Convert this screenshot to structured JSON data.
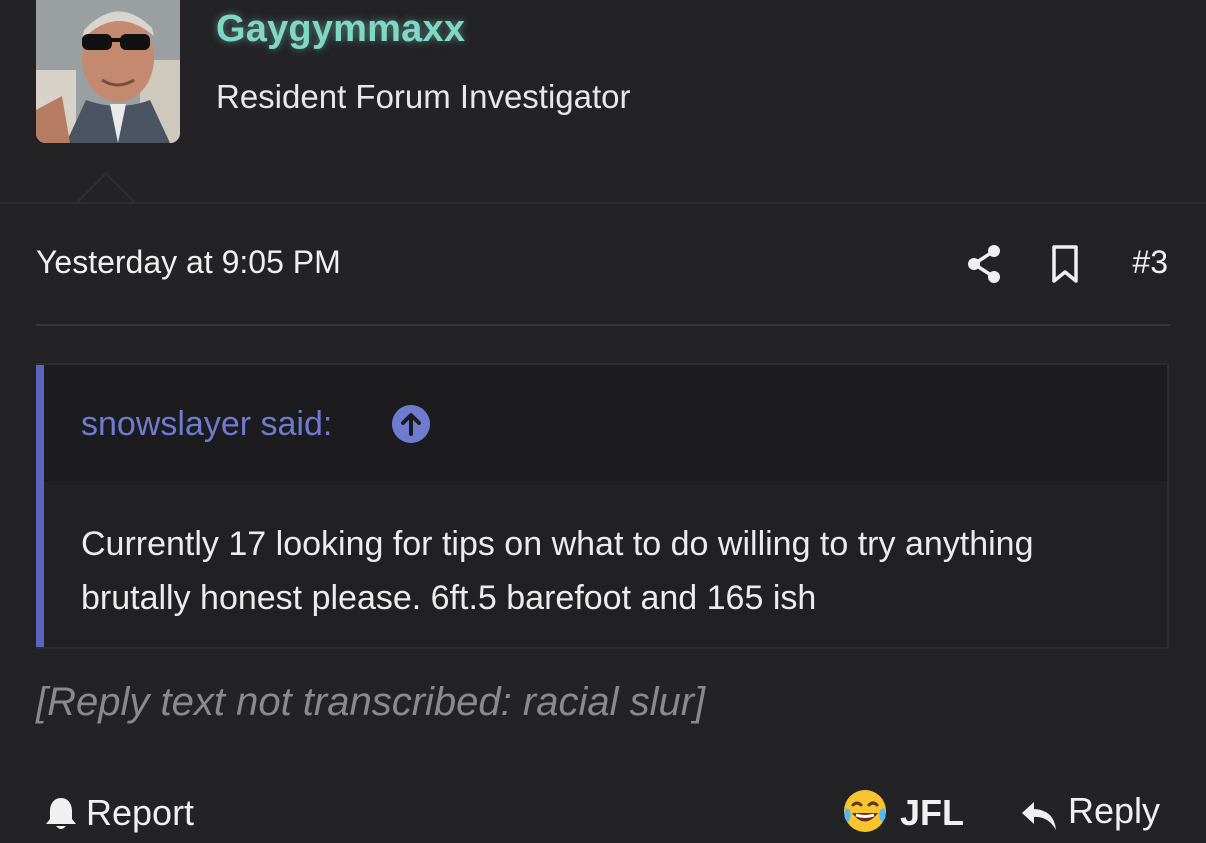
{
  "user": {
    "name": "Gaygymmaxx",
    "title": "Resident Forum Investigator",
    "name_color": "#7fd7c4"
  },
  "post": {
    "timestamp": "Yesterday at 9:05 PM",
    "number": "#3",
    "body": "[Reply text not transcribed: racial slur]"
  },
  "quote": {
    "author": "snowslayer said:",
    "text": "Currently 17 looking for tips on what to do willing to try anything brutally honest please. 6ft.5 barefoot and 165 ish",
    "accent_color": "#5b65c0"
  },
  "actions": {
    "report_label": "Report",
    "reaction_label": "JFL",
    "reply_label": "Reply"
  },
  "icons": {
    "share": "share-icon",
    "bookmark": "bookmark-icon",
    "quote_jump": "arrow-up-circle-icon",
    "report": "bell-icon",
    "reaction": "crying-laughing-emoji-icon",
    "reply": "reply-arrow-icon"
  },
  "colors": {
    "background": "#232325",
    "quote_background": "#212123",
    "quote_header_background": "#1c1c1e",
    "link": "#6f7bd0"
  }
}
